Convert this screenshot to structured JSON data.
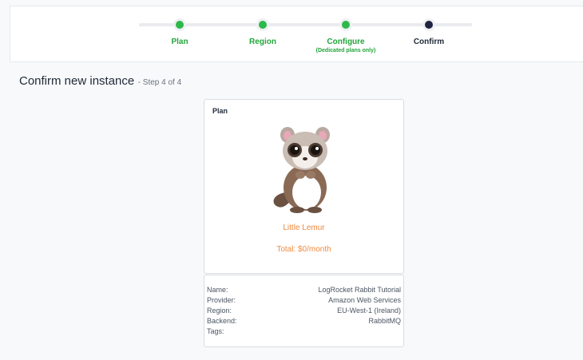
{
  "stepper": {
    "steps": [
      {
        "label": "Plan",
        "sub": "",
        "state": "done"
      },
      {
        "label": "Region",
        "sub": "",
        "state": "done"
      },
      {
        "label": "Configure",
        "sub": "(Dedicated plans only)",
        "state": "done"
      },
      {
        "label": "Confirm",
        "sub": "",
        "state": "current"
      }
    ]
  },
  "heading": {
    "title": "Confirm new instance",
    "step_count": "- Step 4 of 4"
  },
  "plan_card": {
    "label": "Plan",
    "mascot_icon": "lemur-mascot-icon",
    "plan_name": "Little Lemur",
    "total": "Total: $0/month"
  },
  "details": [
    {
      "key": "Name:",
      "value": "LogRocket Rabbit Tutorial"
    },
    {
      "key": "Provider:",
      "value": "Amazon Web Services"
    },
    {
      "key": "Region:",
      "value": "EU-West-1 (Ireland)"
    },
    {
      "key": "Backend:",
      "value": "RabbitMQ"
    },
    {
      "key": "Tags:",
      "value": ""
    }
  ],
  "colors": {
    "done": "#2db84a",
    "current": "#1f2340",
    "accent": "#f08a40"
  }
}
